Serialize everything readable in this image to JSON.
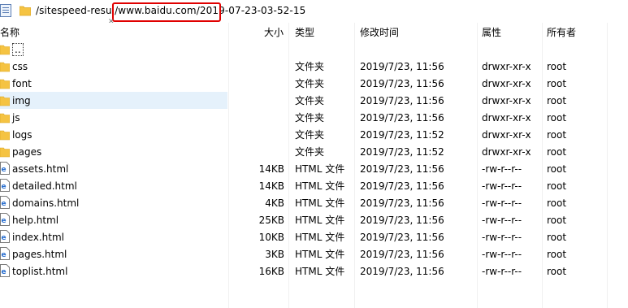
{
  "address_bar": {
    "path_before": "/sitespeed-resul",
    "path_highlighted": "/www.baidu.com/2019",
    "path_after": "-07-23-03-52-15"
  },
  "columns": {
    "name": "名称",
    "size": "大小",
    "type": "类型",
    "modified": "修改时间",
    "permissions": "属性",
    "owner": "所有者"
  },
  "files": [
    {
      "icon": "folder-icon",
      "name": "..",
      "size": "",
      "type": "",
      "modified": "",
      "permissions": "",
      "owner": ""
    },
    {
      "icon": "folder-icon",
      "name": "css",
      "size": "",
      "type": "文件夹",
      "modified": "2019/7/23, 11:56",
      "permissions": "drwxr-xr-x",
      "owner": "root"
    },
    {
      "icon": "folder-icon",
      "name": "font",
      "size": "",
      "type": "文件夹",
      "modified": "2019/7/23, 11:56",
      "permissions": "drwxr-xr-x",
      "owner": "root"
    },
    {
      "icon": "folder-icon",
      "name": "img",
      "size": "",
      "type": "文件夹",
      "modified": "2019/7/23, 11:56",
      "permissions": "drwxr-xr-x",
      "owner": "root"
    },
    {
      "icon": "folder-icon",
      "name": "js",
      "size": "",
      "type": "文件夹",
      "modified": "2019/7/23, 11:56",
      "permissions": "drwxr-xr-x",
      "owner": "root"
    },
    {
      "icon": "folder-icon",
      "name": "logs",
      "size": "",
      "type": "文件夹",
      "modified": "2019/7/23, 11:52",
      "permissions": "drwxr-xr-x",
      "owner": "root"
    },
    {
      "icon": "folder-icon",
      "name": "pages",
      "size": "",
      "type": "文件夹",
      "modified": "2019/7/23, 11:52",
      "permissions": "drwxr-xr-x",
      "owner": "root"
    },
    {
      "icon": "html-file-icon",
      "name": "assets.html",
      "size": "14KB",
      "type": "HTML 文件",
      "modified": "2019/7/23, 11:56",
      "permissions": "-rw-r--r--",
      "owner": "root"
    },
    {
      "icon": "html-file-icon",
      "name": "detailed.html",
      "size": "14KB",
      "type": "HTML 文件",
      "modified": "2019/7/23, 11:56",
      "permissions": "-rw-r--r--",
      "owner": "root"
    },
    {
      "icon": "html-file-icon",
      "name": "domains.html",
      "size": "4KB",
      "type": "HTML 文件",
      "modified": "2019/7/23, 11:56",
      "permissions": "-rw-r--r--",
      "owner": "root"
    },
    {
      "icon": "html-file-icon",
      "name": "help.html",
      "size": "25KB",
      "type": "HTML 文件",
      "modified": "2019/7/23, 11:56",
      "permissions": "-rw-r--r--",
      "owner": "root"
    },
    {
      "icon": "html-file-icon",
      "name": "index.html",
      "size": "10KB",
      "type": "HTML 文件",
      "modified": "2019/7/23, 11:56",
      "permissions": "-rw-r--r--",
      "owner": "root"
    },
    {
      "icon": "html-file-icon",
      "name": "pages.html",
      "size": "3KB",
      "type": "HTML 文件",
      "modified": "2019/7/23, 11:56",
      "permissions": "-rw-r--r--",
      "owner": "root"
    },
    {
      "icon": "html-file-icon",
      "name": "toplist.html",
      "size": "16KB",
      "type": "HTML 文件",
      "modified": "2019/7/23, 11:56",
      "permissions": "-rw-r--r--",
      "owner": "root"
    }
  ],
  "colors": {
    "folder": "#f5c342",
    "folder_dark": "#dba520",
    "selection": "#e5f1fb",
    "highlight_border": "#e00000",
    "html_icon": "#2a6fcf"
  }
}
